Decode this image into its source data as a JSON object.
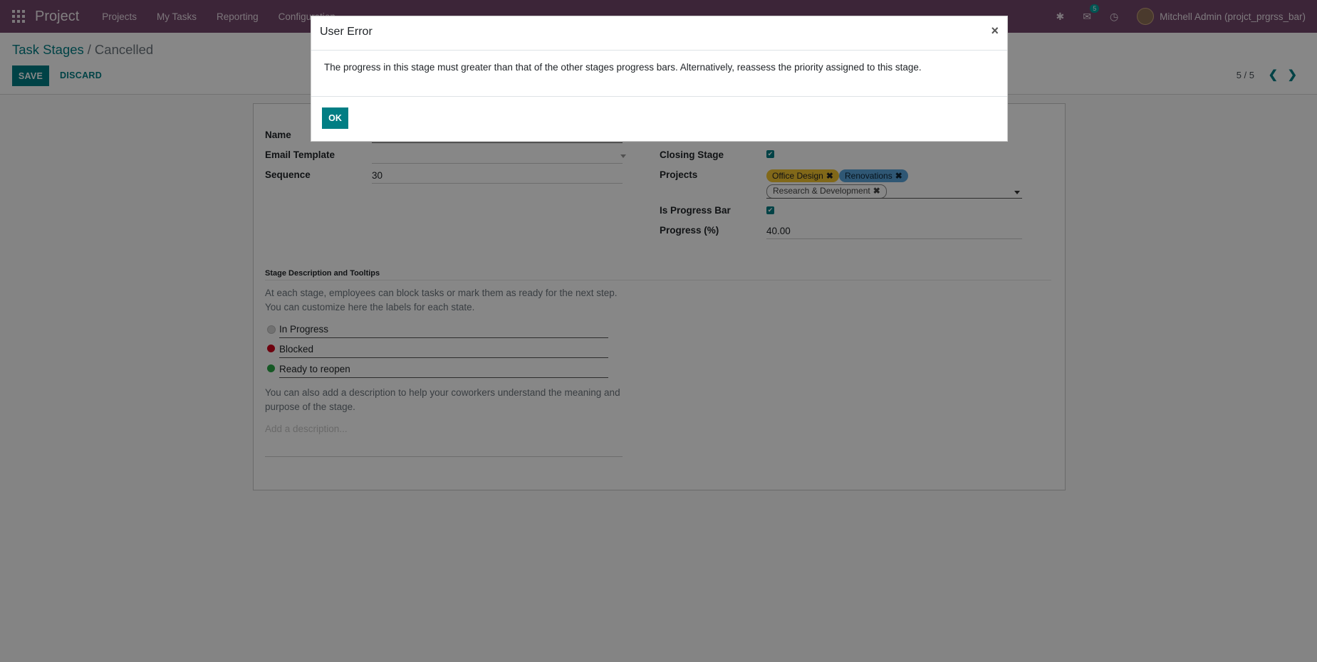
{
  "navbar": {
    "brand": "Project",
    "menu": [
      "Projects",
      "My Tasks",
      "Reporting",
      "Configuration"
    ],
    "messages_badge": "5",
    "user": "Mitchell Admin (projct_prgrss_bar)"
  },
  "breadcrumb": {
    "parent": "Task Stages",
    "separator": "/",
    "current": "Cancelled"
  },
  "actions": {
    "save": "SAVE",
    "discard": "DISCARD"
  },
  "pager": {
    "value": "5 / 5"
  },
  "form": {
    "name_label": "Name",
    "name_value": "",
    "email_template_label": "Email Template",
    "email_template_value": "",
    "sequence_label": "Sequence",
    "sequence_value": "30",
    "closing_stage_label": "Closing Stage",
    "closing_stage_checked": true,
    "projects_label": "Projects",
    "projects_tags": [
      "Office Design",
      "Renovations",
      "Research & Development"
    ],
    "progress_bar_label": "Is Progress Bar",
    "progress_bar_checked": true,
    "progress_label": "Progress (%)",
    "progress_value": "40.00"
  },
  "description_section": {
    "title": "Stage Description and Tooltips",
    "help_1": "At each stage, employees can block tasks or mark them as ready for the next step. You can customize here the labels for each state.",
    "states": [
      {
        "label": "In Progress",
        "color": "#d6d6d6"
      },
      {
        "label": "Blocked",
        "color": "#d0021b"
      },
      {
        "label": "Ready to reopen",
        "color": "#28a745"
      }
    ],
    "help_2": "You can also add a description to help your coworkers understand the meaning and purpose of the stage.",
    "description_placeholder": "Add a description..."
  },
  "dialog": {
    "title": "User Error",
    "close": "×",
    "message": "The progress in this stage must greater than that of the other stages progress bars. Alternatively, reassess the priority assigned to this stage.",
    "ok": "OK"
  }
}
